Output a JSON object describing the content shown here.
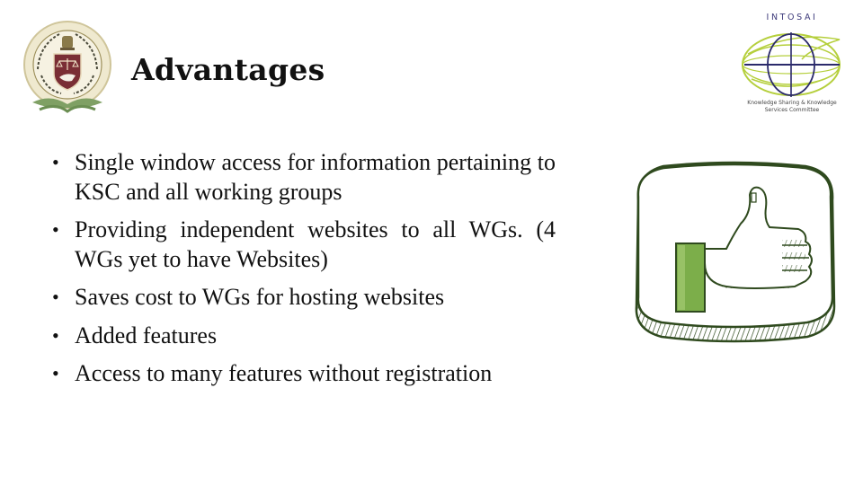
{
  "slide": {
    "title": "Advantages",
    "left_logo": {
      "icon": "cag-india-emblem-icon"
    },
    "right_logo": {
      "icon": "intosai-globe-icon",
      "name": "INTOSAI",
      "caption_line1": "Knowledge Sharing & Knowledge",
      "caption_line2": "Services Committee"
    },
    "bullet_symbol": "•",
    "bullets": [
      {
        "text": "Single window access for information pertaining to KSC and all working groups"
      },
      {
        "text": "Providing independent websites to all WGs. (4 WGs yet to have Websites)"
      },
      {
        "text": "Saves cost to WGs for hosting websites"
      },
      {
        "text": "Added features"
      },
      {
        "text": "Access to many features without registration"
      }
    ],
    "illustration": {
      "icon": "thumbs-up-icon"
    },
    "colors": {
      "accent_green": "#7cae4a",
      "globe_green": "#b5cf3c",
      "globe_navy": "#2b2a6b",
      "emblem_maroon": "#7a2e35",
      "emblem_gold": "#d8cfa6",
      "outline_dark_green": "#2f4a1e"
    }
  }
}
